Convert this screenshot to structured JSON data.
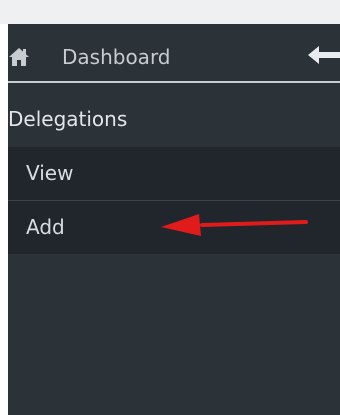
{
  "sidebar": {
    "dashboard_label": "Dashboard",
    "section_title": "Delegations",
    "items": [
      {
        "label": "View"
      },
      {
        "label": "Add"
      }
    ]
  },
  "icons": {
    "home": "home-icon",
    "back": "arrow-left-icon"
  },
  "colors": {
    "sidebar_bg": "#2b3238",
    "item_bg": "#20262b",
    "annotation_arrow": "#e01b1b"
  }
}
